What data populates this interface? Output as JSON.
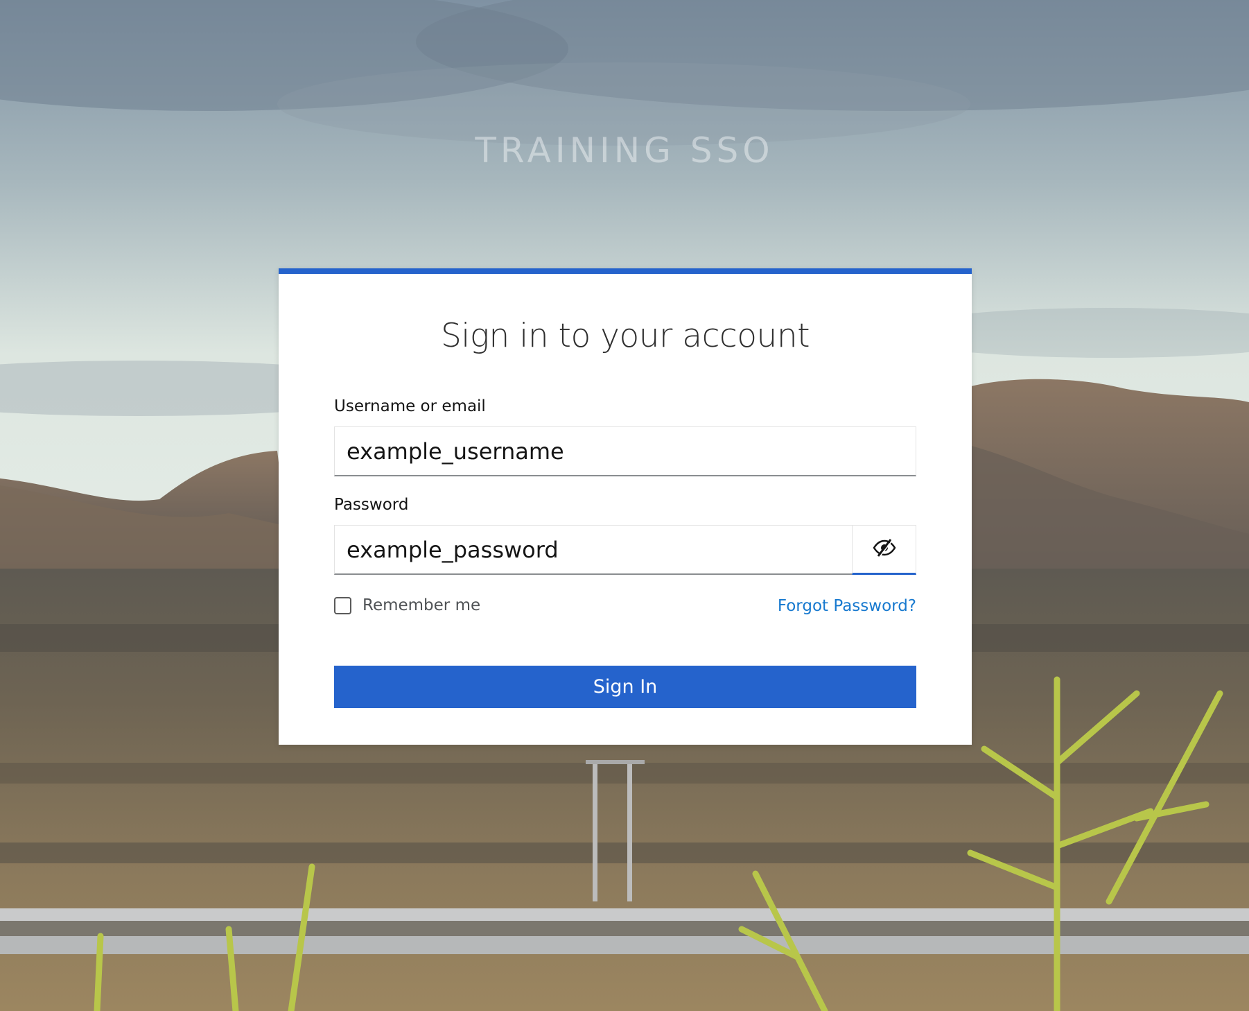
{
  "brand": {
    "name": "TRAINING SSO"
  },
  "login": {
    "title": "Sign in to your account",
    "username_label": "Username or email",
    "username_value": "example_username",
    "password_label": "Password",
    "password_value": "example_password",
    "show_password_icon": "eye-slash-icon",
    "remember_label": "Remember me",
    "remember_checked": false,
    "forgot_label": "Forgot Password?",
    "submit_label": "Sign In"
  },
  "colors": {
    "accent": "#2563cc",
    "link": "#1779cf"
  }
}
